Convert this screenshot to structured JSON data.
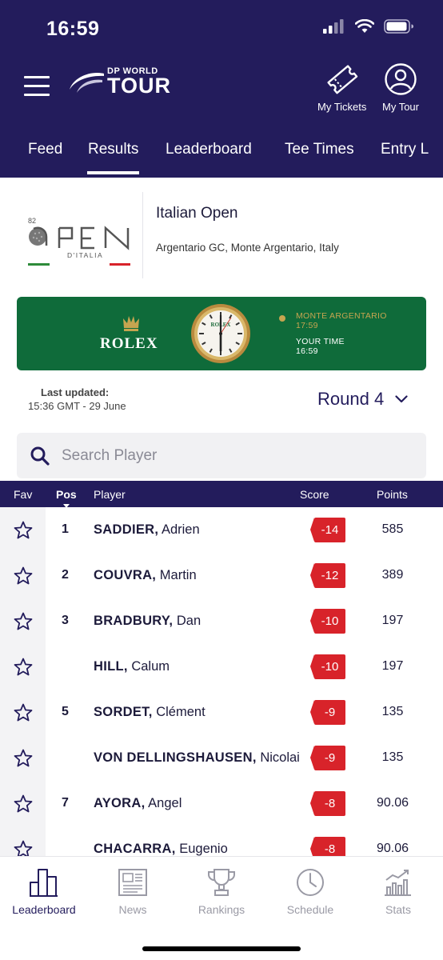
{
  "status": {
    "time": "16:59"
  },
  "header": {
    "logo_small": "DP WORLD",
    "logo_big": "TOUR",
    "tickets_label": "My Tickets",
    "mytour_label": "My Tour"
  },
  "tabs": [
    {
      "label": "Feed"
    },
    {
      "label": "Results"
    },
    {
      "label": "Leaderboard"
    },
    {
      "label": "Tee Times"
    },
    {
      "label": "Entry L"
    }
  ],
  "event": {
    "logo_number": "82",
    "logo_text": "OPEN",
    "logo_sub": "D'ITALIA",
    "title": "Italian Open",
    "venue": "Argentario GC, Monte Argentario, Italy"
  },
  "rolex": {
    "brand": "ROLEX",
    "location_label": "MONTE ARGENTARIO",
    "location_time": "17:59",
    "your_time_label": "YOUR TIME",
    "your_time": "16:59"
  },
  "update": {
    "label": "Last updated:",
    "value": "15:36 GMT - 29 June"
  },
  "round": {
    "label": "Round 4"
  },
  "search": {
    "placeholder": "Search Player"
  },
  "table": {
    "headers": {
      "fav": "Fav",
      "pos": "Pos",
      "player": "Player",
      "score": "Score",
      "points": "Points"
    },
    "rows": [
      {
        "pos": "1",
        "last": "SADDIER,",
        "first": "Adrien",
        "score": "-14",
        "points": "585"
      },
      {
        "pos": "2",
        "last": "COUVRA,",
        "first": "Martin",
        "score": "-12",
        "points": "389"
      },
      {
        "pos": "3",
        "last": "BRADBURY,",
        "first": "Dan",
        "score": "-10",
        "points": "197"
      },
      {
        "pos": "",
        "last": "HILL,",
        "first": "Calum",
        "score": "-10",
        "points": "197"
      },
      {
        "pos": "5",
        "last": "SORDET,",
        "first": "Clément",
        "score": "-9",
        "points": "135"
      },
      {
        "pos": "",
        "last": "VON DELLINGSHAUSEN,",
        "first": "Nicolai",
        "score": "-9",
        "points": "135"
      },
      {
        "pos": "7",
        "last": "AYORA,",
        "first": "Angel",
        "score": "-8",
        "points": "90.06"
      },
      {
        "pos": "",
        "last": "CHACARRA,",
        "first": "Eugenio",
        "score": "-8",
        "points": "90.06"
      }
    ]
  },
  "bottom_nav": [
    {
      "label": "Leaderboard",
      "icon": "leaderboard-bars-icon",
      "active": true
    },
    {
      "label": "News",
      "icon": "newspaper-icon",
      "active": false
    },
    {
      "label": "Rankings",
      "icon": "trophy-icon",
      "active": false
    },
    {
      "label": "Schedule",
      "icon": "clock-icon",
      "active": false
    },
    {
      "label": "Stats",
      "icon": "stats-chart-icon",
      "active": false
    }
  ],
  "colors": {
    "brand_navy": "#231c5c",
    "score_red": "#d8232a",
    "rolex_green": "#0f6b3a",
    "rolex_gold": "#c6a550",
    "inactive_nav": "#9a9aa5"
  }
}
